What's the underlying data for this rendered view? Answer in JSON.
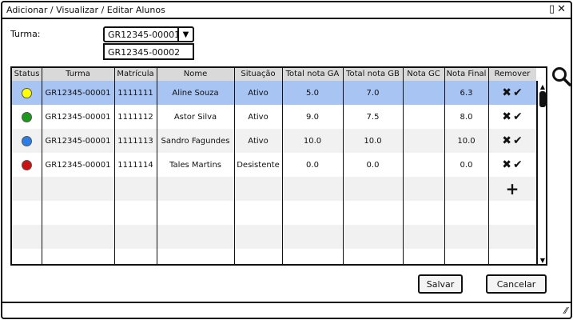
{
  "window": {
    "title": "Adicionar / Visualizar / Editar Alunos",
    "restore_icon": "▯",
    "close_icon": "✕"
  },
  "turma": {
    "label": "Turma:",
    "selected": "GR12345-00001",
    "dropdown_option": "GR12345-00002"
  },
  "table": {
    "headers": [
      "Status",
      "Turma",
      "Matrícula",
      "Nome",
      "Situação",
      "Total nota GA",
      "Total nota GB",
      "Nota GC",
      "Nota Final",
      "Remover"
    ],
    "rows": [
      {
        "status_color": "#ffff00",
        "turma": "GR12345-00001",
        "matricula": "1111111",
        "nome": "Aline Souza",
        "situacao": "Ativo",
        "ga": "5.0",
        "gb": "7.0",
        "gc": "",
        "final": "6.3",
        "selected": true
      },
      {
        "status_color": "#1a9a1a",
        "turma": "GR12345-00001",
        "matricula": "1111112",
        "nome": "Astor Silva",
        "situacao": "Ativo",
        "ga": "9.0",
        "gb": "7.5",
        "gc": "",
        "final": "8.0",
        "selected": false
      },
      {
        "status_color": "#2a7ee8",
        "turma": "GR12345-00001",
        "matricula": "1111113",
        "nome": "Sandro Fagundes",
        "situacao": "Ativo",
        "ga": "10.0",
        "gb": "10.0",
        "gc": "",
        "final": "10.0",
        "selected": false
      },
      {
        "status_color": "#d01010",
        "turma": "GR12345-00001",
        "matricula": "1111114",
        "nome": "Tales Martins",
        "situacao": "Desistente",
        "ga": "0.0",
        "gb": "0.0",
        "gc": "",
        "final": "0.0",
        "selected": false
      }
    ],
    "remove_icon": "✖",
    "confirm_icon": "✔",
    "add_icon": "+"
  },
  "buttons": {
    "save": "Salvar",
    "cancel": "Cancelar"
  }
}
